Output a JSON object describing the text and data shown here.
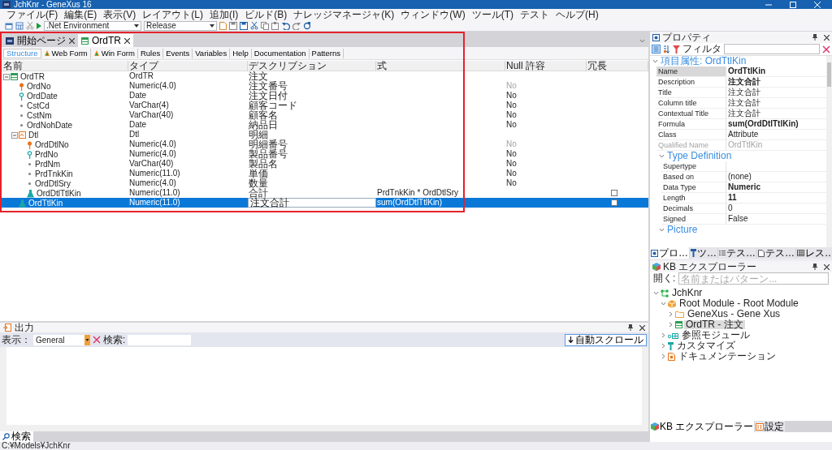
{
  "window": {
    "title": "JchKnr - GeneXus 16"
  },
  "menu": [
    "ファイル(F)",
    "編集(E)",
    "表示(V)",
    "レイアウト(L)",
    "追加(I)",
    "ビルド(B)",
    "ナレッジマネージャ(K)",
    "ウィンドウ(W)",
    "ツール(T)",
    "テスト",
    "ヘルプ(H)"
  ],
  "toolbar": {
    "environment": ".Net Environment",
    "configuration": "Release"
  },
  "editor_tabs": [
    {
      "label": "開始ページ",
      "kind": "start",
      "selected": false
    },
    {
      "label": "OrdTR",
      "kind": "transaction",
      "selected": true
    }
  ],
  "section_tabs": [
    {
      "label": "Structure",
      "kind": "plain",
      "selected": true
    },
    {
      "label": "Web Form",
      "kind": "form",
      "selected": false
    },
    {
      "label": "Win Form",
      "kind": "form",
      "selected": false
    },
    {
      "label": "Rules",
      "kind": "plain",
      "selected": false
    },
    {
      "label": "Events",
      "kind": "plain",
      "selected": false
    },
    {
      "label": "Variables",
      "kind": "plain",
      "selected": false
    },
    {
      "label": "Help",
      "kind": "plain",
      "selected": false
    },
    {
      "label": "Documentation",
      "kind": "plain",
      "selected": false
    },
    {
      "label": "Patterns",
      "kind": "plain",
      "selected": false
    }
  ],
  "structure": {
    "columns": [
      "名前",
      "タイプ",
      "デスクリプション",
      "式",
      "Null 許容",
      "冗長"
    ],
    "rows": [
      {
        "name": "OrdTR",
        "kind": "transaction",
        "type": "OrdTR",
        "description": "注文",
        "expanded": true,
        "selected": false,
        "children": [
          {
            "name": "OrdNo",
            "kind": "primary-key",
            "type": "Numeric(4.0)",
            "description": "注文番号",
            "nullable": "No",
            "nullable_disabled": true,
            "selected": false
          },
          {
            "name": "OrdDate",
            "kind": "foreign-key",
            "type": "Date",
            "description": "注文日付",
            "nullable": "No",
            "nullable_disabled": false,
            "selected": false
          },
          {
            "name": "CstCd",
            "kind": "attribute",
            "type": "VarChar(4)",
            "description": "顧客コード",
            "nullable": "No",
            "nullable_disabled": false,
            "selected": false
          },
          {
            "name": "CstNm",
            "kind": "attribute",
            "type": "VarChar(40)",
            "description": "顧客名",
            "nullable": "No",
            "nullable_disabled": false,
            "selected": false
          },
          {
            "name": "OrdNohDate",
            "kind": "attribute",
            "type": "Date",
            "description": "納品日",
            "nullable": "No",
            "nullable_disabled": false,
            "selected": false
          },
          {
            "name": "Dtl",
            "kind": "level",
            "type": "Dtl",
            "description": "明細",
            "expanded": true,
            "selected": false,
            "children": [
              {
                "name": "OrdDtlNo",
                "kind": "primary-key",
                "type": "Numeric(4.0)",
                "description": "明細番号",
                "nullable": "No",
                "nullable_disabled": true,
                "selected": false
              },
              {
                "name": "PrdNo",
                "kind": "foreign-key",
                "type": "Numeric(4.0)",
                "description": "製品番号",
                "nullable": "No",
                "nullable_disabled": false,
                "selected": false
              },
              {
                "name": "PrdNm",
                "kind": "attribute",
                "type": "VarChar(40)",
                "description": "製品名",
                "nullable": "No",
                "nullable_disabled": false,
                "selected": false
              },
              {
                "name": "PrdTnkKin",
                "kind": "attribute",
                "type": "Numeric(11.0)",
                "description": "単価",
                "nullable": "No",
                "nullable_disabled": false,
                "selected": false
              },
              {
                "name": "OrdDtlSry",
                "kind": "attribute",
                "type": "Numeric(4.0)",
                "description": "数量",
                "nullable": "No",
                "nullable_disabled": false,
                "selected": false
              },
              {
                "name": "OrdDtlTtlKin",
                "kind": "formula",
                "type": "Numeric(11.0)",
                "description": "合計",
                "formula": "PrdTnkKin * OrdDtlSry",
                "redundant_checked": false,
                "selected": false
              }
            ]
          },
          {
            "name": "OrdTtlKin",
            "kind": "formula",
            "type": "Numeric(11.0)",
            "description": "注文合計",
            "formula": "sum(OrdDtlTtlKin)",
            "redundant_checked": false,
            "selected": true
          }
        ]
      }
    ]
  },
  "properties": {
    "title": "プロパティ",
    "filter_label": "フィルタ",
    "groups": [
      {
        "label": "項目属性: OrdTtlKin",
        "expanded": true,
        "rows": [
          {
            "name": "Name",
            "value": "OrdTtlKin",
            "bold": true,
            "disabled": false,
            "selected": true
          },
          {
            "name": "Description",
            "value": "注文合計",
            "bold": true,
            "disabled": false,
            "selected": false
          },
          {
            "name": "Title",
            "value": "注文合計",
            "bold": false,
            "disabled": false,
            "selected": false
          },
          {
            "name": "Column title",
            "value": "注文合計",
            "bold": false,
            "disabled": false,
            "selected": false
          },
          {
            "name": "Contextual Title",
            "value": "注文合計",
            "bold": false,
            "disabled": false,
            "selected": false
          },
          {
            "name": "Formula",
            "value": "sum(OrdDtlTtlKin)",
            "bold": true,
            "disabled": false,
            "selected": false
          },
          {
            "name": "Class",
            "value": "Attribute",
            "bold": false,
            "disabled": false,
            "selected": false
          },
          {
            "name": "Qualified Name",
            "value": "OrdTtlKin",
            "bold": false,
            "disabled": true,
            "selected": false
          }
        ],
        "children": [
          {
            "label": "Type Definition",
            "expanded": true,
            "rows": [
              {
                "name": "Supertype",
                "disabled": false,
                "selected": false
              },
              {
                "name": "Based on",
                "value": "(none)",
                "bold": false,
                "disabled": false,
                "selected": false
              },
              {
                "name": "Data Type",
                "value": "Numeric",
                "bold": true,
                "disabled": false,
                "selected": false
              },
              {
                "name": "Length",
                "value": "11",
                "bold": true,
                "disabled": false,
                "selected": false
              },
              {
                "name": "Decimals",
                "value": "0",
                "bold": false,
                "disabled": false,
                "selected": false
              },
              {
                "name": "Signed",
                "value": "False",
                "bold": false,
                "disabled": false,
                "selected": false
              }
            ]
          },
          {
            "label": "Picture",
            "expanded": true
          }
        ]
      }
    ],
    "tabs": [
      {
        "label": "プロ…",
        "kind": "properties",
        "selected": true
      },
      {
        "label": "ツ…",
        "kind": "toolbox",
        "selected": false
      },
      {
        "label": "テス…",
        "kind": "list",
        "selected": false
      },
      {
        "label": "テス…",
        "kind": "document",
        "selected": false
      },
      {
        "label": "レス…",
        "kind": "grid",
        "selected": false
      }
    ]
  },
  "kb_explorer": {
    "title": "KB エクスプローラー",
    "open_label": "開く:",
    "search": {
      "placeholder": "名前またはパターン..."
    },
    "tree": [
      {
        "label": "JchKnr",
        "kind": "kb",
        "expanded": true,
        "selected": false,
        "children": [
          {
            "label": "Root Module - Root Module",
            "kind": "module",
            "expanded": true,
            "selected": false,
            "children": [
              {
                "label": "GeneXus - Gene Xus",
                "kind": "folder",
                "expanded": false,
                "selected": false
              },
              {
                "label": "OrdTR - 注文",
                "kind": "transaction",
                "expanded": false,
                "selected": true
              }
            ]
          },
          {
            "label": "参照モジュール",
            "kind": "reference",
            "expanded": false,
            "selected": false
          },
          {
            "label": "カスタマイズ",
            "kind": "customize",
            "expanded": false,
            "selected": false
          },
          {
            "label": "ドキュメンテーション",
            "kind": "document",
            "expanded": false,
            "selected": false
          }
        ]
      }
    ],
    "tabs": [
      {
        "label": "KB エクスプローラー",
        "kind": "kb",
        "selected": true
      },
      {
        "label": "設定",
        "kind": "settings",
        "selected": false
      }
    ]
  },
  "output": {
    "title": "出力",
    "show_label": "表示：",
    "show_value": "General",
    "search_label": "検索:",
    "autoscroll_label": "自動スクロール"
  },
  "bottom_tabs": [
    {
      "label": "検索",
      "selected": true
    }
  ],
  "status_bar": {
    "path": "C:¥Models¥JchKnr"
  }
}
